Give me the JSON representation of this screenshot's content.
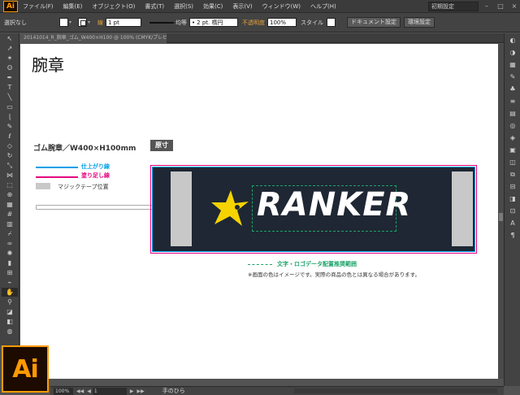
{
  "menubar": {
    "app_icon": "Ai",
    "items": [
      "ファイル(F)",
      "編集(E)",
      "オブジェクト(O)",
      "書式(T)",
      "選択(S)",
      "効果(C)",
      "表示(V)",
      "ウィンドウ(W)",
      "ヘルプ(H)"
    ],
    "workspace": "初期設定",
    "window_controls": [
      "–",
      "□",
      "×"
    ]
  },
  "controlbar": {
    "selection_status": "選択なし",
    "stroke_label": "線",
    "stroke_weight": "1 pt",
    "stroke_profile_label": "均等",
    "brush_value": "2 pt. 楕円",
    "opacity_label": "不透明度",
    "opacity_value": "100%",
    "style_label": "スタイル",
    "doc_setup_button": "ドキュメント設定",
    "preferences_button": "環境設定"
  },
  "document_tab": {
    "label": "20141014_R_腕章_ゴム_W400×H100 @ 100% (CMYK/プレビュー)"
  },
  "canvas": {
    "heading": "腕章",
    "product_label": "ゴム腕章／W400×H100mm",
    "badge": "原寸",
    "legend": {
      "finish_line": "仕上がり線",
      "bleed_line": "塗り足し線",
      "velcro": "マジックテープ位置"
    },
    "logo_text": "RANKER",
    "logo_area_legend": "文字・ロゴデータ配置推奨範囲",
    "color_note": "※画面の色はイメージです。実際の商品の色とは異なる場合があります。"
  },
  "colors": {
    "finish_line": "#00a0e9",
    "bleed_line": "#e4007f",
    "logo_area": "#1ca36a",
    "armband_bg": "#1e2733",
    "star": "#f5d300",
    "velcro": "#c8c8c8",
    "app_accent": "#ff9a00"
  },
  "statusbar": {
    "zoom": "100%",
    "nav_first": "◀◀",
    "nav_prev": "◀",
    "artboard": "1",
    "nav_next": "▶",
    "nav_last": "▶▶",
    "current_tool": "手のひら"
  },
  "branding": {
    "big_logo": "Ai"
  }
}
